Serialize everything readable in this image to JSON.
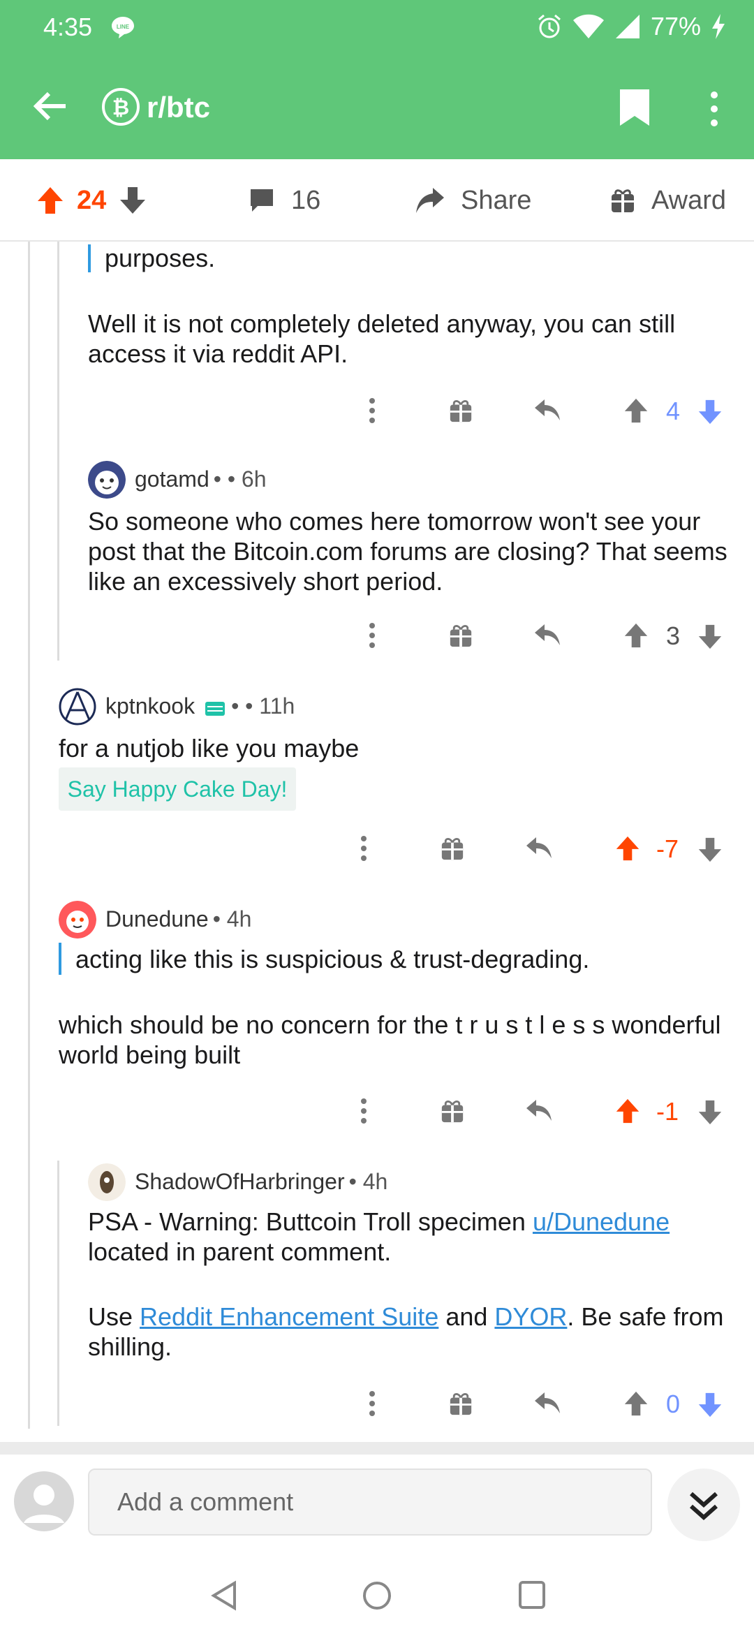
{
  "status_bar": {
    "time": "4:35",
    "battery": "77%"
  },
  "app_bar": {
    "subreddit": "r/btc"
  },
  "post_actions": {
    "score": "24",
    "comments": "16",
    "share_label": "Share",
    "award_label": "Award"
  },
  "comments": [
    {
      "quote": "purposes.",
      "body": "Well it is not completely deleted anyway, you can still access it via reddit API.",
      "score": "4"
    },
    {
      "author": "gotamd",
      "sep": "•",
      "age": "• 6h",
      "body": "So someone who comes here tomorrow won't see your post that the Bitcoin.com forums are closing? That seems like an excessively short period.",
      "score": "3"
    },
    {
      "author": "kptnkook",
      "sep": "•",
      "age": "• 11h",
      "body": "for a nutjob like you maybe",
      "cake_day_label": "Say Happy Cake Day!",
      "score": "-7"
    },
    {
      "author": "Dunedune",
      "age": "• 4h",
      "quote": "acting like this is suspicious & trust-degrading.",
      "body": "which should be no concern for the t r u s t l e s s wonderful world being built",
      "score": "-1"
    },
    {
      "author": "ShadowOfHarbringer",
      "age": "• 4h",
      "body_part1": "PSA - Warning: Buttcoin Troll specimen ",
      "link_user": "u/Dunedune",
      "body_part2": "located in parent comment.",
      "body2_prefix": "Use ",
      "link_res": "Reddit Enhancement Suite",
      "body2_mid": " and ",
      "link_dyor": "DYOR",
      "body2_suffix": ". Be safe from shilling.",
      "score": "0"
    }
  ],
  "composer": {
    "placeholder": "Add a comment"
  },
  "colors": {
    "header": "#5fc779",
    "upvote": "#ff4500",
    "downvote": "#7193ff",
    "cake": "#1fc2a8",
    "link": "#2f8bd8"
  }
}
